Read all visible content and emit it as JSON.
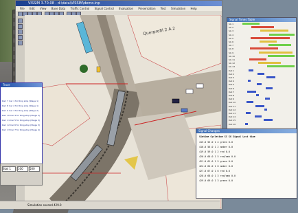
{
  "window": {
    "title": "VISSIM 3.70-08 - d:\\data\\VISSIM\\demo.inp",
    "menu": [
      "File",
      "Edit",
      "View",
      "Base Data",
      "Traffic Control",
      "Signal Control",
      "Evaluation",
      "Presentation",
      "Test",
      "Simulation",
      "Help"
    ]
  },
  "map": {
    "street_label": "Querprofil 2 A.2"
  },
  "signal_panel": {
    "title": "Signal Times Table",
    "rows": [
      "SG 1",
      "SG 2",
      "SG 3",
      "SG 4",
      "SG 5",
      "SG 6",
      "SG 7",
      "SG 8",
      "SG 9",
      "SG 10",
      "SG 11",
      "SG 12",
      "SG 13",
      "Det 1",
      "Det 2",
      "Det 3",
      "Det 4",
      "Det 5",
      "Det 6",
      "Det 7",
      "Det 8",
      "Det 9",
      "Det 10",
      "Det 11",
      "Det 12",
      "Det 13",
      "Det 14",
      "Det 15",
      "Det 16"
    ]
  },
  "protocol_panel": {
    "title": "Signal Changes",
    "header": "Simtime  Cycletime  SC  SG  Signal  Lost time",
    "rows": [
      "415.0   55.0   1  4   green    0.0",
      "416.0   56.0   1  2   amber    0.0",
      "419.0   59.0   1  2   red      0.0",
      "420.0   60.0   1  5   red/amb  0.0",
      "421.0   61.0   1  5   green    0.0",
      "424.0   64.0   1  6   amber    0.0",
      "427.0   67.0   1  6   red      0.0",
      "428.0   68.0   1  3   red/amb  0.0",
      "429.0   69.0   1  3   green    0.0"
    ]
  },
  "left_dialog": {
    "title": "Trace",
    "lines": [
      "Det. 7 Car 1 for Ring stop (Stage 1)",
      "Det. 8 Car 2 for Ring stop (Stage 1)",
      "Det. 9 Car 3 for Ring stop (Stage 2)",
      "Det. 10 Car 4 for Ring stop (Stage 2)",
      "Det. 11 Car 5 for Ring stop (Stage 3)",
      "Det. 12 Car 6 for Ring stop (Stage 3)",
      "Det. 13 Car 7 for Ring stop (Stage 4)"
    ],
    "field1": "Stat 1",
    "field2": "100",
    "field3": "500"
  },
  "status": {
    "text": "Simulation second 429.0"
  }
}
